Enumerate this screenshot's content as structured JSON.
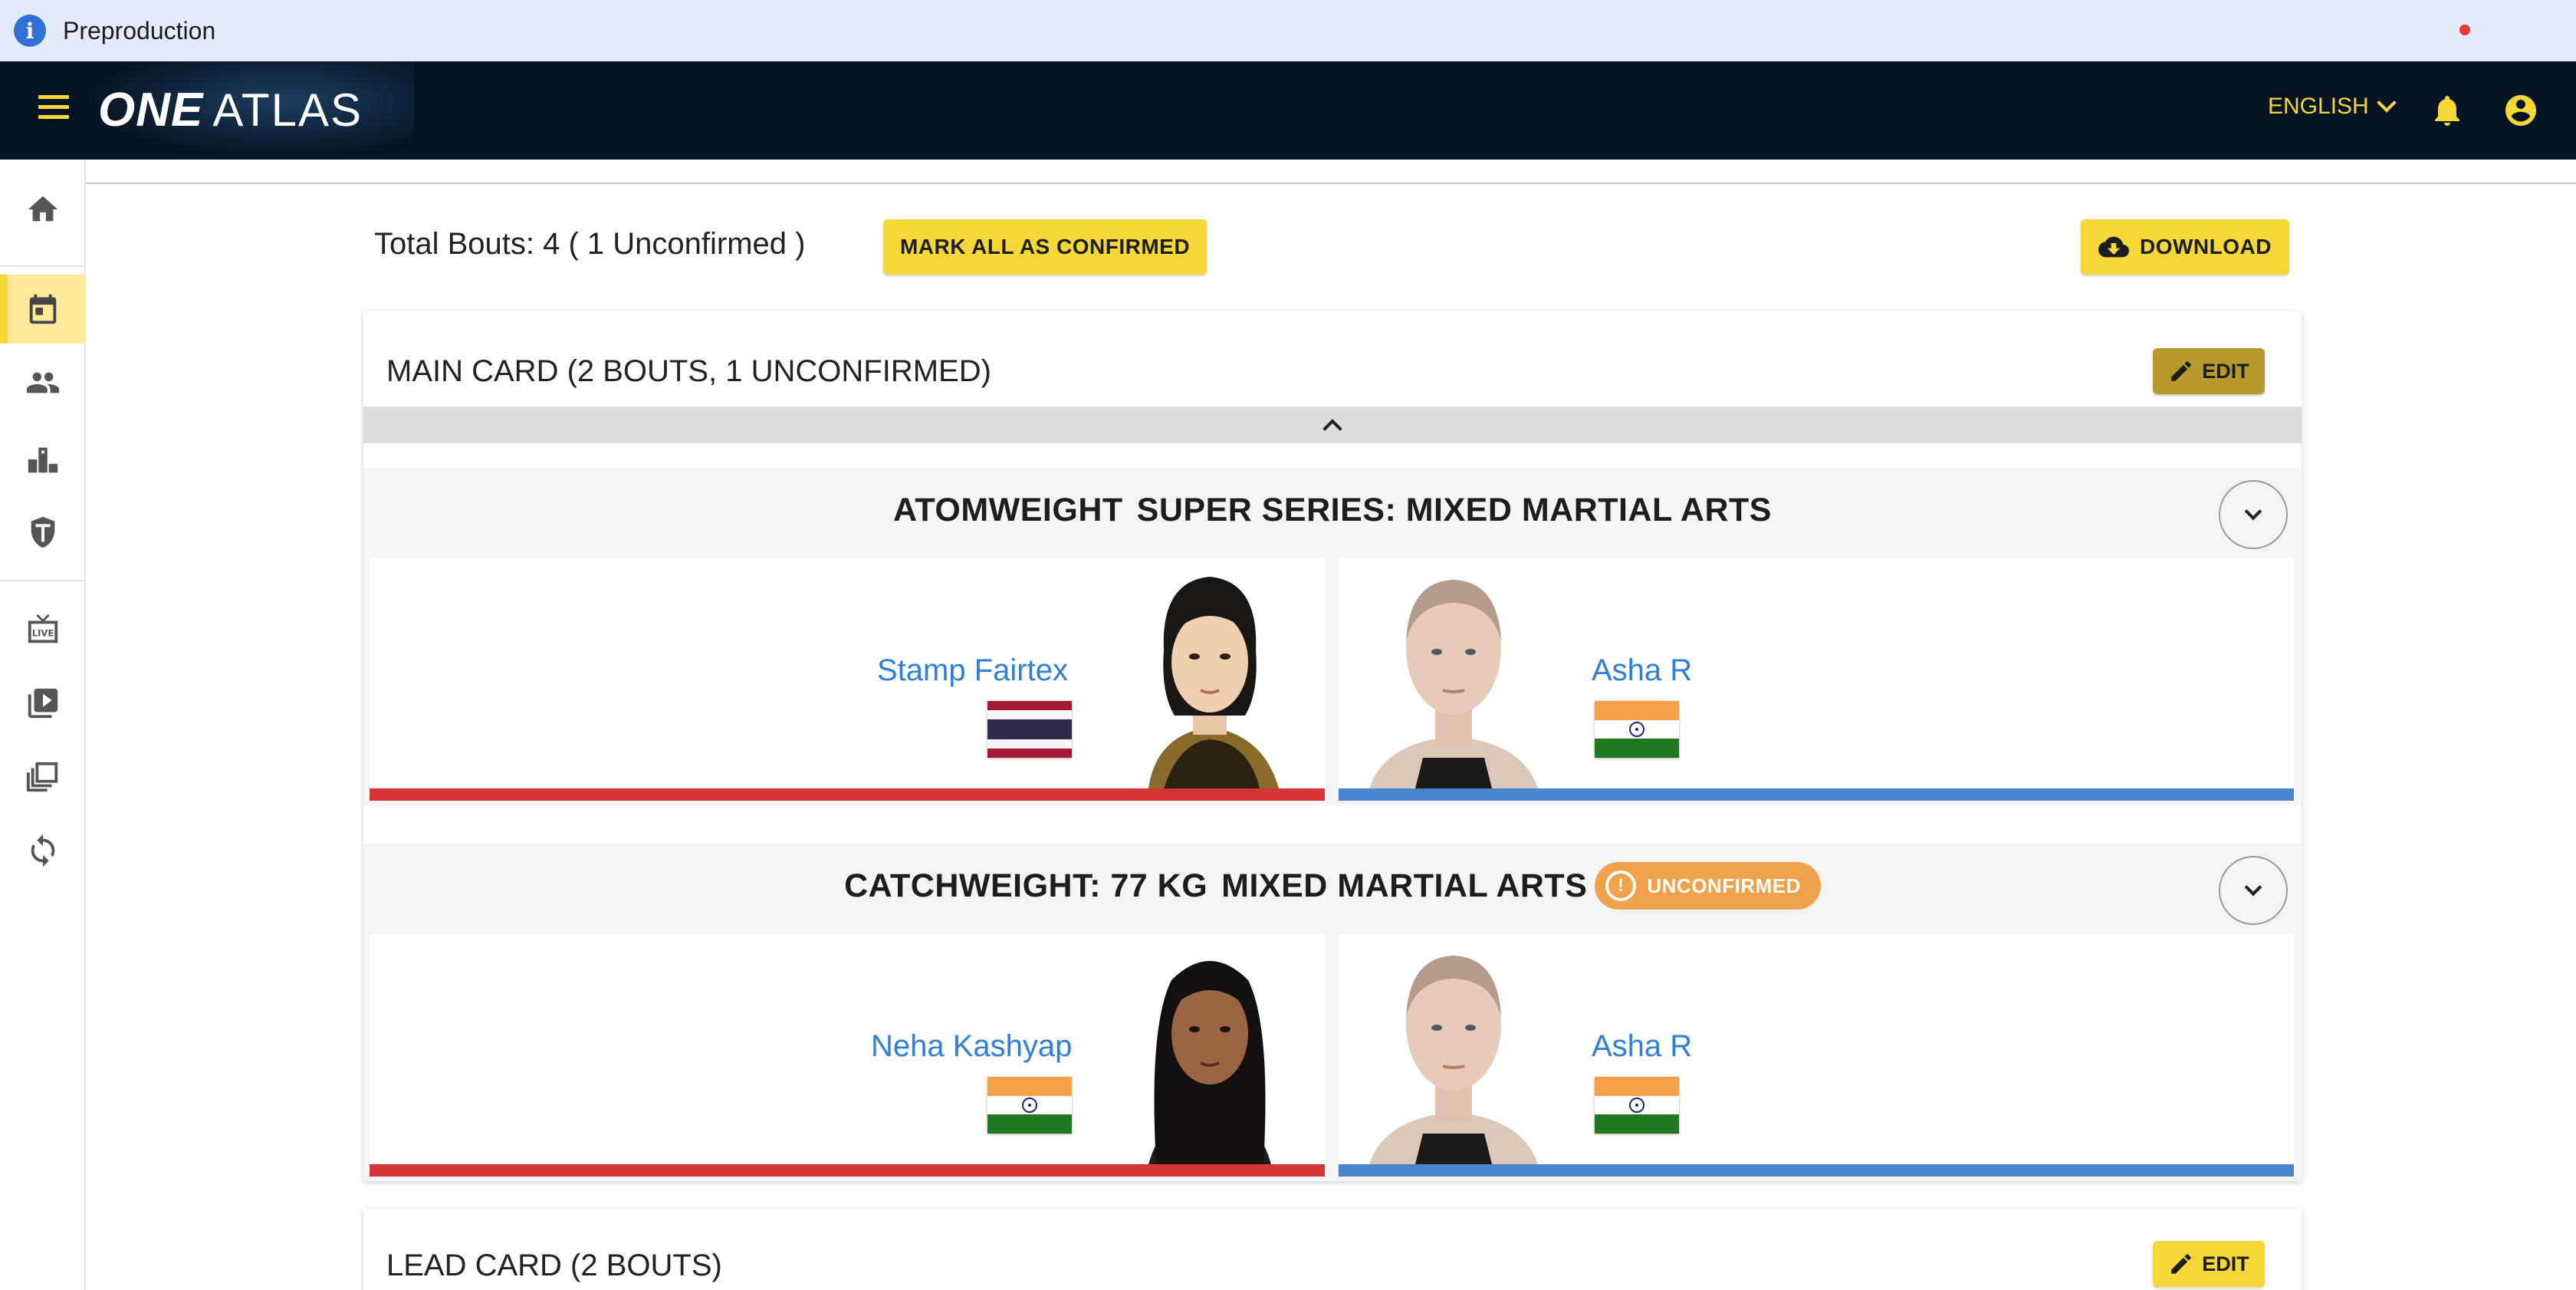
{
  "env_banner": {
    "text": "Preproduction",
    "icon": "info-icon"
  },
  "header": {
    "logo_one": "ONE",
    "logo_atlas": "ATLAS",
    "language": "ENGLISH",
    "notification_dot_color": "#e53935",
    "accent_color": "#f5d735"
  },
  "sidebar": {
    "items": [
      {
        "icon": "home-icon"
      },
      {
        "icon": "calendar-icon",
        "active": true
      },
      {
        "icon": "people-icon"
      },
      {
        "icon": "podium-icon"
      },
      {
        "icon": "shield-icon"
      },
      {
        "icon": "live-tv-icon"
      },
      {
        "icon": "video-library-icon"
      },
      {
        "icon": "collections-icon"
      },
      {
        "icon": "sync-icon"
      }
    ]
  },
  "summary": {
    "total_text": "Total Bouts: 4 ( 1 Unconfirmed )",
    "mark_all_label": "MARK ALL AS CONFIRMED",
    "download_label": "DOWNLOAD"
  },
  "cards": [
    {
      "title": "MAIN CARD (2 BOUTS, 1 UNCONFIRMED)",
      "edit_label": "EDIT",
      "bouts": [
        {
          "weight_class": "ATOMWEIGHT",
          "discipline": "SUPER SERIES: MIXED MARTIAL ARTS",
          "unconfirmed": false,
          "red": {
            "name": "Stamp Fairtex",
            "country": "Thailand"
          },
          "blue": {
            "name": "Asha R",
            "country": "India"
          }
        },
        {
          "weight_class": "CATCHWEIGHT: 77 KG",
          "discipline": "MIXED MARTIAL ARTS",
          "unconfirmed": true,
          "badge_label": "UNCONFIRMED",
          "red": {
            "name": "Neha Kashyap",
            "country": "India"
          },
          "blue": {
            "name": "Asha R",
            "country": "India"
          }
        }
      ]
    },
    {
      "title": "LEAD CARD (2 BOUTS)",
      "edit_label": "EDIT"
    }
  ],
  "colors": {
    "red_corner": "#d63434",
    "blue_corner": "#4a86d0",
    "unconfirmed_badge": "#f0a24a",
    "link": "#2f7fd8"
  }
}
